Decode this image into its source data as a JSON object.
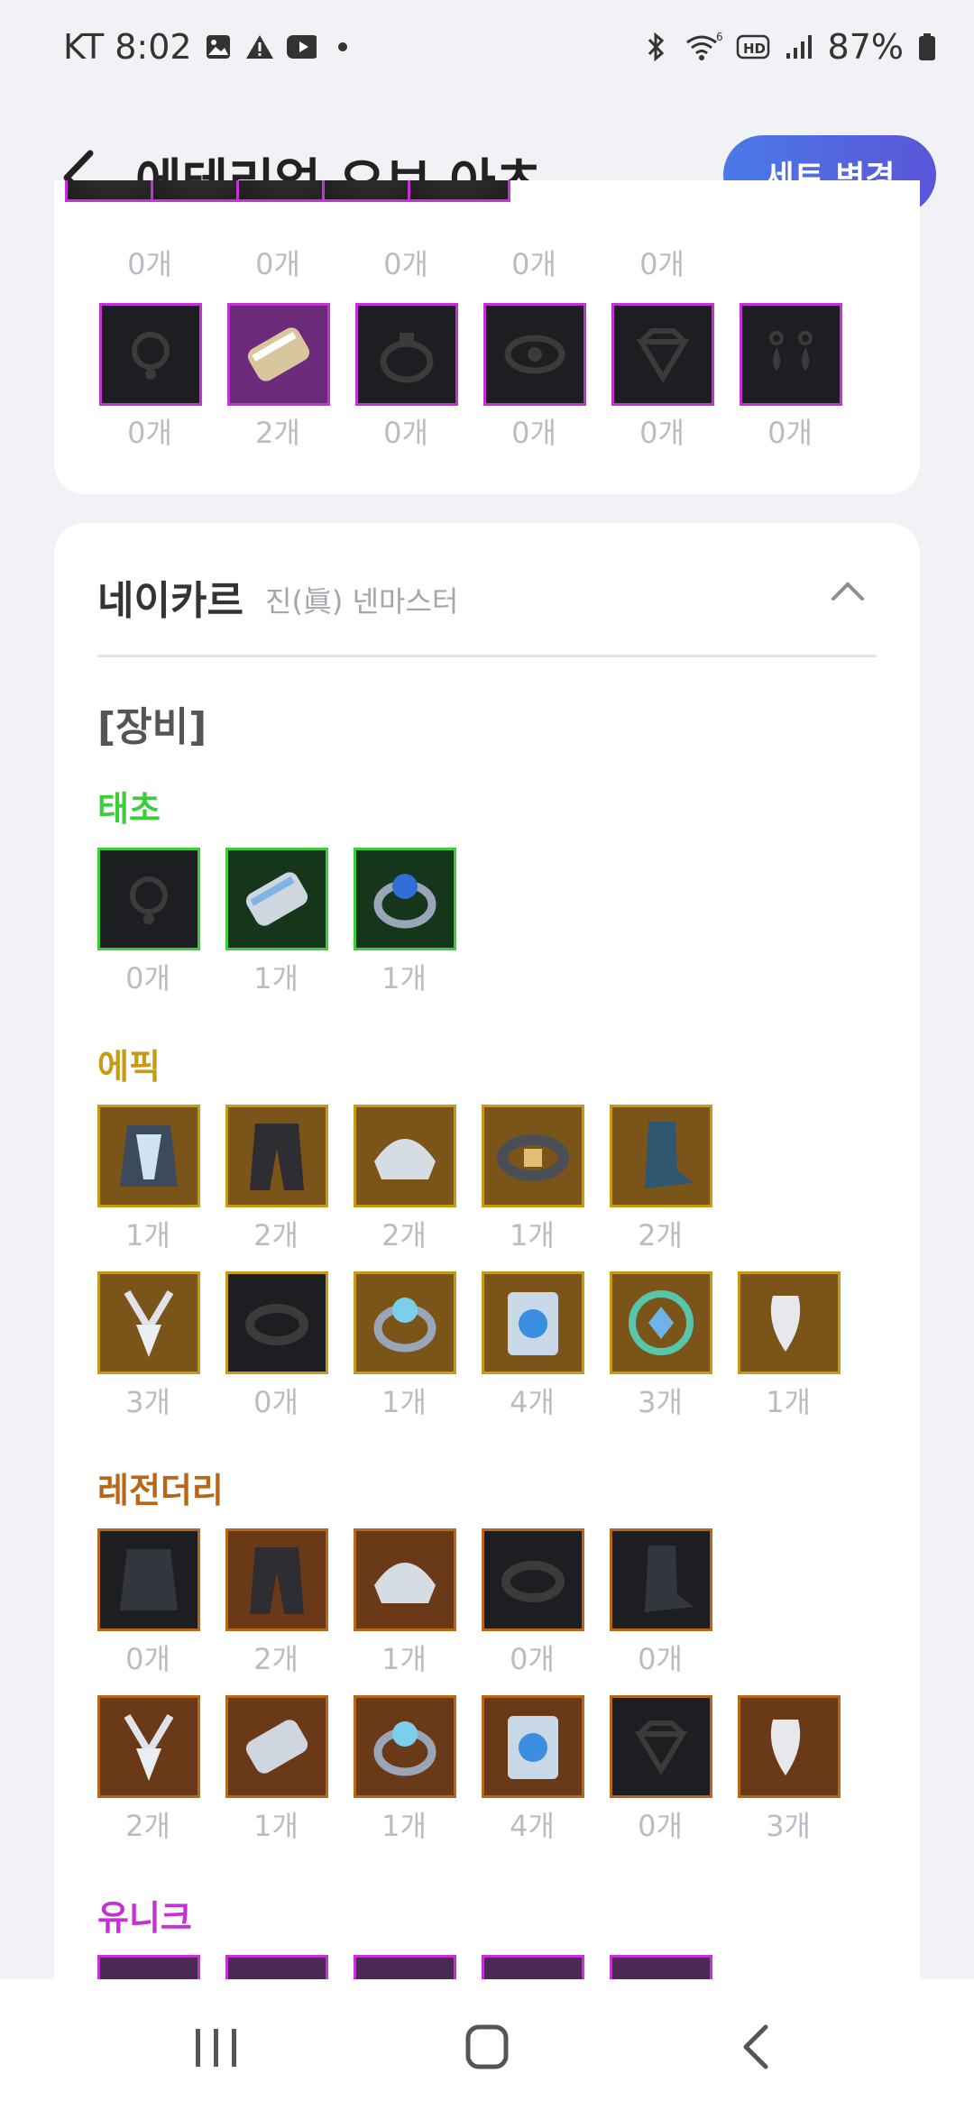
{
  "status": {
    "carrier_time": "KT 8:02",
    "battery": "87%",
    "network": "HD",
    "wifi_badge": "6"
  },
  "header": {
    "title": "에테리얼 오브 아츠",
    "set_button": "세트 변경"
  },
  "card1": {
    "top_counts": [
      "0개",
      "0개",
      "0개",
      "0개",
      "0개"
    ],
    "row_counts": [
      "0개",
      "2개",
      "0개",
      "0개",
      "0개",
      "0개"
    ]
  },
  "card2": {
    "char_name": "네이카르",
    "char_class": "진(眞) 넨마스터",
    "section": "[장비]",
    "grades": {
      "taecho": "태초",
      "epic": "에픽",
      "legend": "레전더리",
      "unique": "유니크"
    },
    "taecho_counts": [
      "0개",
      "1개",
      "1개"
    ],
    "epic_row1": [
      "1개",
      "2개",
      "2개",
      "1개",
      "2개"
    ],
    "epic_row2": [
      "3개",
      "0개",
      "1개",
      "4개",
      "3개",
      "1개"
    ],
    "legend_row1": [
      "0개",
      "2개",
      "1개",
      "0개",
      "0개"
    ],
    "legend_row2": [
      "2개",
      "1개",
      "1개",
      "4개",
      "0개",
      "3개"
    ]
  },
  "colors": {
    "taecho": "#3ccc3c",
    "epic": "#c79a14",
    "legend": "#b86618",
    "unique": "#c531d4",
    "accent": "#4a6ee0"
  }
}
